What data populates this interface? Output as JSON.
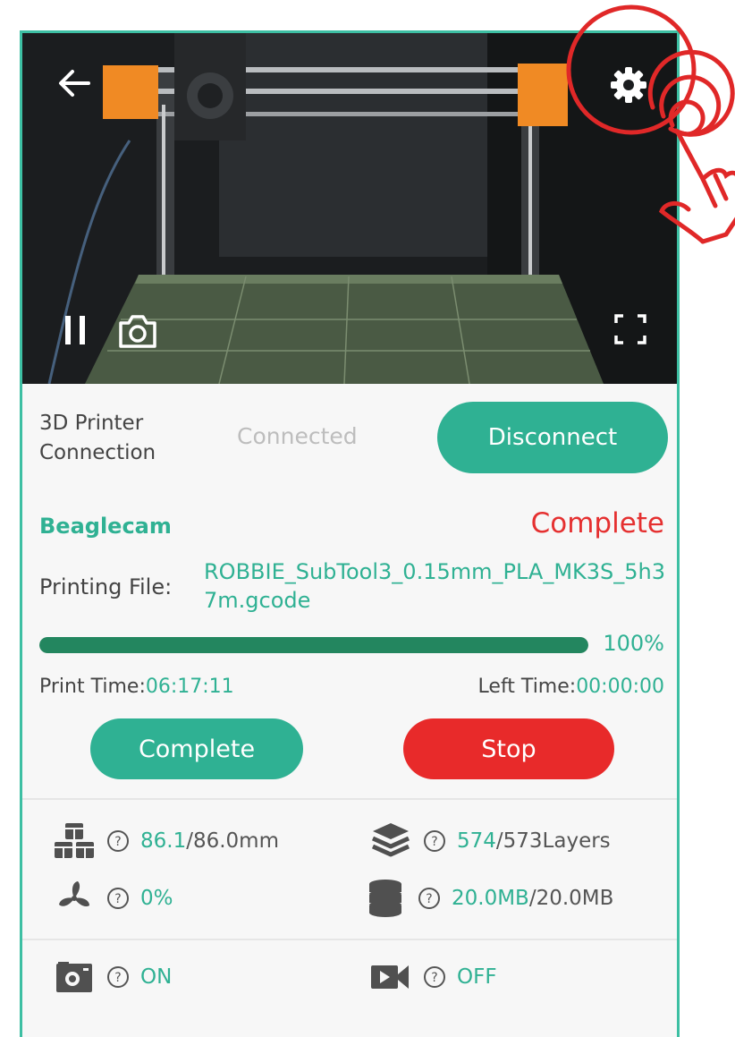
{
  "camera": {
    "back_icon": "arrow-left-icon",
    "settings_icon": "gear-icon",
    "pause_icon": "pause-icon",
    "snapshot_icon": "camera-icon",
    "fullscreen_icon": "fullscreen-icon"
  },
  "connection": {
    "label": "3D Printer Connection",
    "status": "Connected",
    "disconnect_label": "Disconnect"
  },
  "job": {
    "camera_name": "Beaglecam",
    "state": "Complete",
    "file_label": "Printing File:",
    "file_name": "ROBBIE_SubTool3_0.15mm_PLA_MK3S_5h37m.gcode",
    "progress_fraction": 1.0,
    "progress_text": "100%",
    "print_time_label": "Print Time:",
    "print_time_value": "06:17:11",
    "left_time_label": "Left Time:",
    "left_time_value": "00:00:00",
    "complete_label": "Complete",
    "stop_label": "Stop"
  },
  "stats": {
    "height_current": "86.1",
    "height_total": "/86.0mm",
    "layers_current": "574",
    "layers_total": "/573Layers",
    "fan_value": "0%",
    "storage_current": "20.0MB",
    "storage_total": "/20.0MB",
    "timelapse_value": "ON",
    "record_value": "OFF"
  },
  "colors": {
    "accent": "#2fb193",
    "danger": "#e82a2a",
    "progress": "#23865f"
  }
}
